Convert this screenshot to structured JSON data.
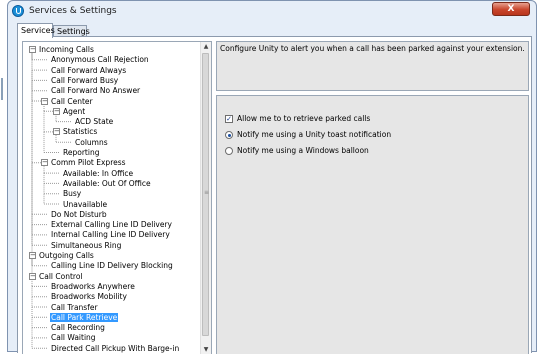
{
  "window": {
    "title": "Services & Settings",
    "close_label": "X"
  },
  "tabs": [
    {
      "label": "Services",
      "active": true
    },
    {
      "label": "Settings",
      "active": false
    }
  ],
  "tree": {
    "items": [
      {
        "label": "Incoming Calls",
        "level": 0,
        "expander": "−"
      },
      {
        "label": "Anonymous Call Rejection",
        "level": 1
      },
      {
        "label": "Call Forward Always",
        "level": 1
      },
      {
        "label": "Call Forward Busy",
        "level": 1
      },
      {
        "label": "Call Forward No Answer",
        "level": 1
      },
      {
        "label": "Call Center",
        "level": 1,
        "expander": "−"
      },
      {
        "label": "Agent",
        "level": 2,
        "expander": "−"
      },
      {
        "label": "ACD State",
        "level": 3
      },
      {
        "label": "Statistics",
        "level": 2,
        "expander": "−"
      },
      {
        "label": "Columns",
        "level": 3
      },
      {
        "label": "Reporting",
        "level": 2
      },
      {
        "label": "Comm Pilot Express",
        "level": 1,
        "expander": "−"
      },
      {
        "label": "Available: In Office",
        "level": 2
      },
      {
        "label": "Available: Out Of Office",
        "level": 2
      },
      {
        "label": "Busy",
        "level": 2
      },
      {
        "label": "Unavailable",
        "level": 2
      },
      {
        "label": "Do Not Disturb",
        "level": 1
      },
      {
        "label": "External Calling Line ID Delivery",
        "level": 1
      },
      {
        "label": "Internal Calling Line ID Delivery",
        "level": 1
      },
      {
        "label": "Simultaneous Ring",
        "level": 1
      },
      {
        "label": "Outgoing Calls",
        "level": 0,
        "expander": "−"
      },
      {
        "label": "Calling Line ID Delivery Blocking",
        "level": 1
      },
      {
        "label": "Call Control",
        "level": 0,
        "expander": "−"
      },
      {
        "label": "Broadworks Anywhere",
        "level": 1
      },
      {
        "label": "Broadworks Mobility",
        "level": 1
      },
      {
        "label": "Call Transfer",
        "level": 1
      },
      {
        "label": "Call Park Retrieve",
        "level": 1,
        "selected": true
      },
      {
        "label": "Call Recording",
        "level": 1
      },
      {
        "label": "Call Waiting",
        "level": 1
      },
      {
        "label": "Directed Call Pickup With Barge-in",
        "level": 1
      }
    ]
  },
  "scrollbar": {
    "up": "▲",
    "down": "▼",
    "grip": "≡"
  },
  "description": "Configure Unity to alert you when a call has been parked against your extension.",
  "options": {
    "allow_retrieve": {
      "label": "Allow me to to retrieve parked calls",
      "checked": true,
      "mark": "✓"
    },
    "notify_toast": {
      "label": "Notify me using a Unity toast notification",
      "selected": true
    },
    "notify_balloon": {
      "label": "Notify me using a Windows balloon",
      "selected": false
    }
  }
}
